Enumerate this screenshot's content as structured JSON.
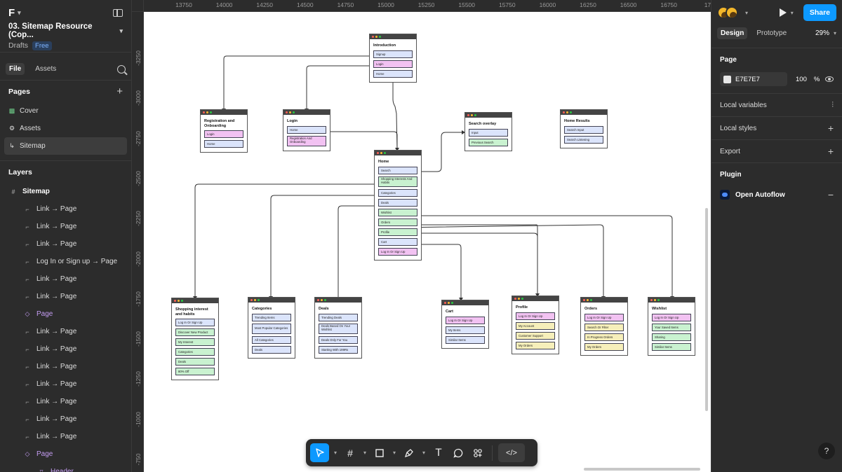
{
  "app": {
    "logo": "F",
    "file_name": "03. Sitemap Resource (Cop...",
    "project": "Drafts",
    "plan_badge": "Free"
  },
  "left_tabs": {
    "file": "File",
    "assets": "Assets"
  },
  "pages": {
    "heading": "Pages",
    "items": [
      {
        "label": "Cover",
        "icon": "image-icon"
      },
      {
        "label": "Assets",
        "icon": "gear-icon"
      },
      {
        "label": "Sitemap",
        "icon": "return-arrow-icon"
      }
    ]
  },
  "layers": {
    "heading": "Layers",
    "root": "Sitemap",
    "items": [
      "Link → Page",
      "Link → Page",
      "Link → Page",
      "Log In or Sign up → Page",
      "Link → Page",
      "Link → Page",
      "Page",
      "Link → Page",
      "Link → Page",
      "Link → Page",
      "Link → Page",
      "Link → Page",
      "Link → Page",
      "Link → Page",
      "Page",
      "Header"
    ]
  },
  "rulers": {
    "top": [
      "13750",
      "14000",
      "14250",
      "14500",
      "14750",
      "15000",
      "15250",
      "15500",
      "15750",
      "16000",
      "16250",
      "16500",
      "16750",
      "170"
    ],
    "left": [
      "-3250",
      "-3000",
      "-2750",
      "-2500",
      "-2250",
      "-2000",
      "-1750",
      "-1500",
      "-1250",
      "-1000",
      "-750"
    ]
  },
  "canvas": {
    "background": "#ffffff"
  },
  "frames": [
    {
      "id": "introduction",
      "title": "Introduction",
      "items": [
        {
          "label": "Signup",
          "color": "blue"
        },
        {
          "label": "Login",
          "color": "pink"
        },
        {
          "label": "Home",
          "color": "blue"
        }
      ]
    },
    {
      "id": "registration",
      "title": "Registration and Onboarding",
      "items": [
        {
          "label": "Login",
          "color": "pink"
        },
        {
          "label": "Home",
          "color": "blue"
        }
      ]
    },
    {
      "id": "login",
      "title": "Login",
      "items": [
        {
          "label": "Home",
          "color": "blue"
        },
        {
          "label": "Registration And Onboarding",
          "color": "pink"
        }
      ]
    },
    {
      "id": "search-overlay",
      "title": "Search overlay",
      "items": [
        {
          "label": "Input",
          "color": "blue"
        },
        {
          "label": "Previous Search",
          "color": "green"
        }
      ]
    },
    {
      "id": "home-results",
      "title": "Home Results",
      "items": [
        {
          "label": "Search Input",
          "color": "blue"
        },
        {
          "label": "Search Listening",
          "color": "blue"
        }
      ]
    },
    {
      "id": "home",
      "title": "Home",
      "items": [
        {
          "label": "Search",
          "color": "blue"
        },
        {
          "label": "Shopping Interests And Habits",
          "color": "green"
        },
        {
          "label": "Categories",
          "color": "blue"
        },
        {
          "label": "Deals",
          "color": "blue"
        },
        {
          "label": "Wishlist",
          "color": "green"
        },
        {
          "label": "Orders",
          "color": "green"
        },
        {
          "label": "Profile",
          "color": "green"
        },
        {
          "label": "Cart",
          "color": "blue"
        },
        {
          "label": "Log In Or Sign Up",
          "color": "pink"
        }
      ]
    },
    {
      "id": "shopping",
      "title": "Shopping interest and habits",
      "items": [
        {
          "label": "Log In Or Sign Up",
          "color": "blue"
        },
        {
          "label": "Discover New Product",
          "color": "green"
        },
        {
          "label": "My Interest",
          "color": "green"
        },
        {
          "label": "Categories",
          "color": "green"
        },
        {
          "label": "Deals",
          "color": "green"
        },
        {
          "label": "80% Off",
          "color": "green"
        }
      ]
    },
    {
      "id": "categories",
      "title": "Categories",
      "items": [
        {
          "label": "Trending Items",
          "color": "blue"
        },
        {
          "label": "Most Popular Categories",
          "color": "blue"
        },
        {
          "label": "All Categories",
          "color": "blue"
        },
        {
          "label": "Deals",
          "color": "blue"
        }
      ]
    },
    {
      "id": "deals",
      "title": "Deals",
      "items": [
        {
          "label": "Trending Deals",
          "color": "blue"
        },
        {
          "label": "Deals Based On Your Wishlist",
          "color": "blue"
        },
        {
          "label": "Deals Only For You",
          "color": "blue"
        },
        {
          "label": "Starting With 199Rs",
          "color": "blue"
        }
      ]
    },
    {
      "id": "cart",
      "title": "Cart",
      "items": [
        {
          "label": "Log In Or Sign Up",
          "color": "pink"
        },
        {
          "label": "My Items",
          "color": "blue"
        },
        {
          "label": "Similar Items",
          "color": "blue"
        }
      ]
    },
    {
      "id": "profile",
      "title": "Profile",
      "items": [
        {
          "label": "Log In Or Sign Up",
          "color": "pink"
        },
        {
          "label": "My Account",
          "color": "yellow"
        },
        {
          "label": "Customer Support",
          "color": "yellow"
        },
        {
          "label": "My Orders",
          "color": "yellow"
        }
      ]
    },
    {
      "id": "orders",
      "title": "Orders",
      "items": [
        {
          "label": "Log In Or Sign Up",
          "color": "pink"
        },
        {
          "label": "Search Or Filter",
          "color": "yellow"
        },
        {
          "label": "In Progress Orders",
          "color": "yellow"
        },
        {
          "label": "My Orders",
          "color": "yellow"
        }
      ]
    },
    {
      "id": "wishlist",
      "title": "Wishlist",
      "items": [
        {
          "label": "Log In Or Sign Up",
          "color": "pink"
        },
        {
          "label": "Your Saved Items",
          "color": "green"
        },
        {
          "label": "Sharing",
          "color": "green"
        },
        {
          "label": "Similar Items",
          "color": "green"
        }
      ]
    }
  ],
  "toolbar": {
    "tools": [
      {
        "name": "move-tool",
        "icon": "cursor-icon",
        "active": true
      },
      {
        "name": "frame-tool",
        "icon": "hash-icon",
        "active": false
      },
      {
        "name": "shape-tool",
        "icon": "rectangle-icon",
        "active": false
      },
      {
        "name": "pen-tool",
        "icon": "pen-icon",
        "active": false
      },
      {
        "name": "text-tool",
        "icon": "text-icon",
        "active": false
      },
      {
        "name": "comment-tool",
        "icon": "comment-icon",
        "active": false
      },
      {
        "name": "actions-tool",
        "icon": "actions-icon",
        "active": false
      },
      {
        "name": "dev-mode",
        "icon": "code-icon",
        "active": false
      }
    ],
    "accent": "#0d99ff"
  },
  "right": {
    "share": "Share",
    "tabs": {
      "design": "Design",
      "prototype": "Prototype"
    },
    "zoom": "29%",
    "page_heading": "Page",
    "page_color": "E7E7E7",
    "page_opacity": "100",
    "percent": "%",
    "local_variables": "Local variables",
    "local_styles": "Local styles",
    "export": "Export",
    "plugin_heading": "Plugin",
    "plugin_name": "Open Autoflow"
  },
  "help": "?"
}
